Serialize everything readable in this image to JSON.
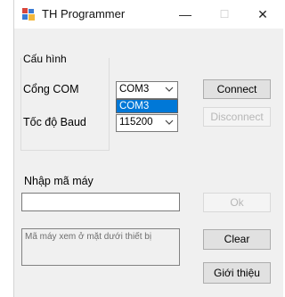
{
  "window": {
    "title": "TH Programmer",
    "minimize_glyph": "—",
    "maximize_glyph": "☐",
    "close_glyph": "✕"
  },
  "config": {
    "group_label": "Cấu hình",
    "com_label": "Cổng COM",
    "com_value": "COM3",
    "com_options": [
      "COM3"
    ],
    "baud_label": "Tốc độ Baud",
    "baud_value": "115200",
    "connect_label": "Connect",
    "disconnect_label": "Disconnect"
  },
  "machine": {
    "group_label": "Nhập mã máy",
    "code_value": "",
    "ok_label": "Ok"
  },
  "note": {
    "text": "Mã máy xem ở mặt dưới thiết bị"
  },
  "actions": {
    "clear_label": "Clear",
    "about_label": "Giới thiệu"
  },
  "colors": {
    "selection": "#0078d7",
    "window_bg": "#f0f0f0"
  }
}
